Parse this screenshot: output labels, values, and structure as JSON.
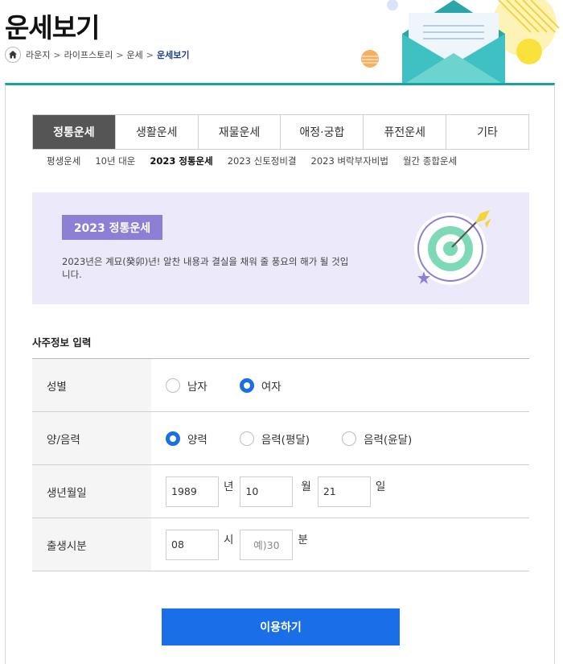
{
  "header": {
    "title": "운세보기",
    "breadcrumb": [
      "라운지",
      "라이프스토리",
      "운세",
      "운세보기"
    ],
    "separator": ">"
  },
  "tabs": [
    {
      "label": "정통운세",
      "active": true
    },
    {
      "label": "생활운세",
      "active": false
    },
    {
      "label": "재물운세",
      "active": false
    },
    {
      "label": "애정·궁합",
      "active": false
    },
    {
      "label": "퓨전운세",
      "active": false
    },
    {
      "label": "기타",
      "active": false
    }
  ],
  "subtabs": [
    {
      "label": "평생운세",
      "active": false
    },
    {
      "label": "10년 대운",
      "active": false
    },
    {
      "label": "2023 정통운세",
      "active": true
    },
    {
      "label": "2023 신토정비결",
      "active": false
    },
    {
      "label": "2023 벼락부자비법",
      "active": false
    },
    {
      "label": "월간 종합운세",
      "active": false
    }
  ],
  "banner": {
    "badge": "2023 정통운세",
    "text": "2023년은 계묘(癸卯)년! 알찬 내용과 결실을 채워 줄 풍요의 해가 될 것입니다."
  },
  "form": {
    "section_title": "사주정보 입력",
    "gender": {
      "label": "성별",
      "options": [
        "남자",
        "여자"
      ],
      "selected": "여자"
    },
    "calendar": {
      "label": "양/음력",
      "options": [
        "양력",
        "음력(평달)",
        "음력(윤달)"
      ],
      "selected": "양력"
    },
    "birthdate": {
      "label": "생년월일",
      "year": "1989",
      "year_unit": "년",
      "month": "10",
      "month_unit": "월",
      "day": "21",
      "day_unit": "일"
    },
    "birthtime": {
      "label": "출생시분",
      "hour": "08",
      "hour_unit": "시",
      "minute_placeholder": "예)30",
      "minute_unit": "분"
    },
    "submit_label": "이용하기"
  },
  "colors": {
    "accent_blue": "#1a6ee8",
    "teal_rule": "#17a2a7",
    "banner_bg": "#ece9fb",
    "badge_purple": "#8e7fd6",
    "active_tab": "#555555"
  }
}
